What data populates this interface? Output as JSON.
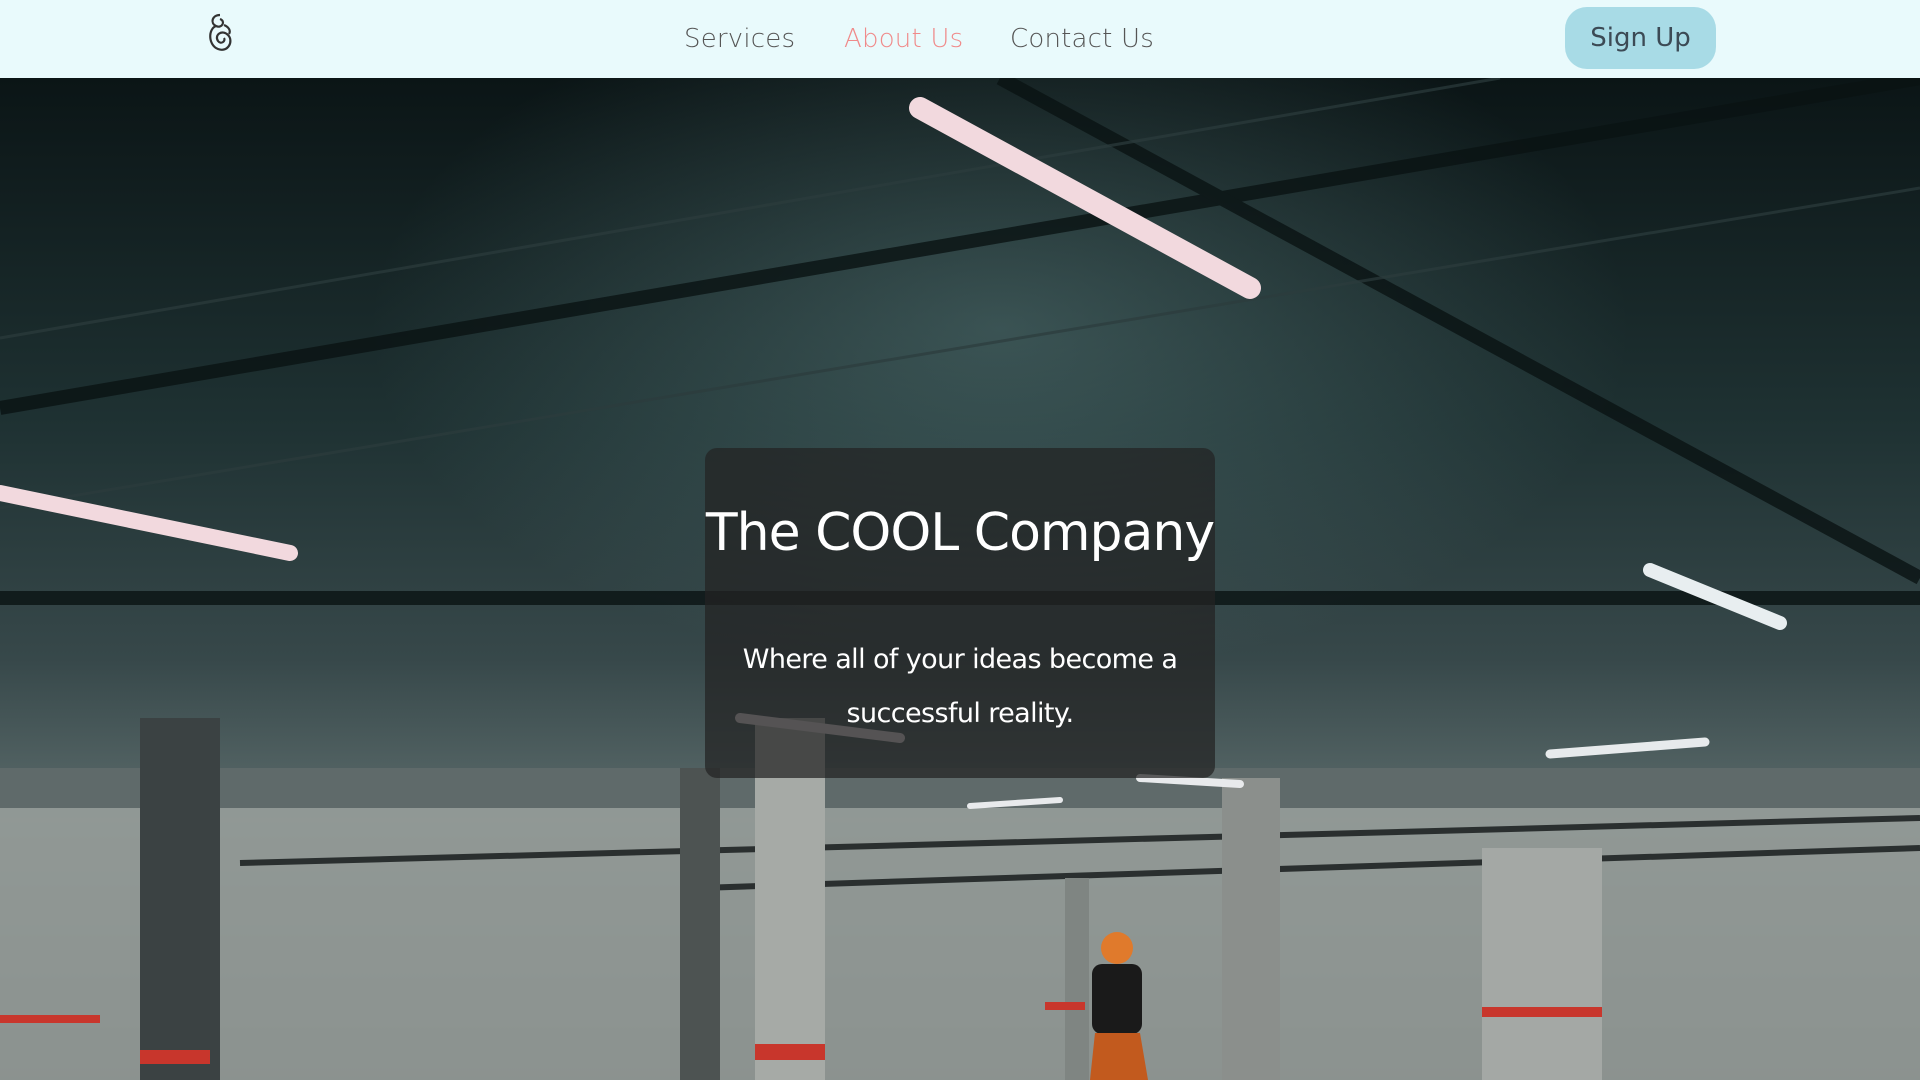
{
  "nav": {
    "logo_icon": "knot-logo-icon",
    "links": [
      {
        "label": "Services",
        "active": false
      },
      {
        "label": "About Us",
        "active": true
      },
      {
        "label": "Contact Us",
        "active": false
      }
    ],
    "signup_label": "Sign Up"
  },
  "hero": {
    "title": "The COOL Company",
    "subtitle": "Where all of your ideas become a successful reality."
  },
  "colors": {
    "nav_bg": "#e9fafc",
    "active_link": "#f08a8a",
    "signup_bg": "#a8dbe6"
  }
}
